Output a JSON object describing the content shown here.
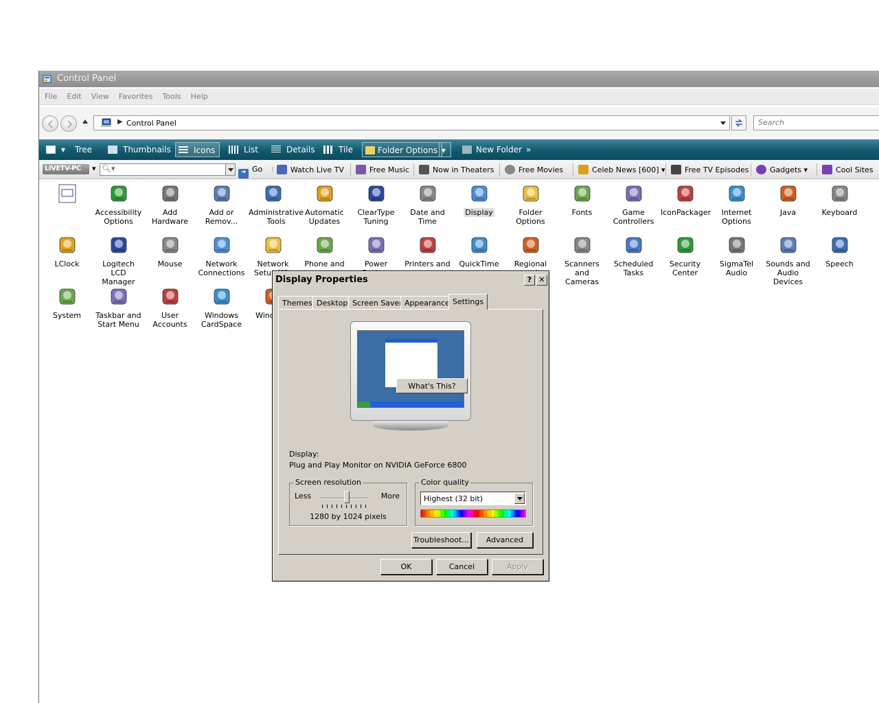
{
  "window": {
    "title": "Control Panel"
  },
  "menubar": [
    "File",
    "Edit",
    "View",
    "Favorites",
    "Tools",
    "Help"
  ],
  "address": {
    "path": "Control Panel",
    "search_placeholder": "Search"
  },
  "commands": {
    "tree": "Tree",
    "thumbnails": "Thumbnails",
    "icons": "Icons",
    "list": "List",
    "details": "Details",
    "tile": "Tile",
    "folder_options": "Folder Options",
    "new_folder": "New Folder",
    "more": "»"
  },
  "links": {
    "logo": "LIVETV-PC",
    "go": "Go",
    "items": [
      "Watch Live TV",
      "Free Music",
      "Now in Theaters",
      "Free Movies",
      "Celeb News [600]",
      "Free TV Episodes",
      "Gadgets",
      "Cool Sites"
    ]
  },
  "items": {
    "r0": [
      "",
      "Accessibility Options",
      "Add Hardware",
      "Add or Remov...",
      "Administrative Tools",
      "Automatic Updates",
      "ClearType Tuning",
      "Date and Time",
      "Display",
      "Folder Options",
      "Fonts",
      "Game Controllers",
      "IconPackager",
      "Internet Options",
      "Java",
      "Keyboard"
    ],
    "r1": [
      "LClock",
      "Logitech LCD Manager",
      "Mouse",
      "Network Connections",
      "Network Setup Wiz",
      "Phone and",
      "Power Options",
      "Printers and",
      "QuickTime",
      "Regional and",
      "Scanners and Cameras",
      "Scheduled Tasks",
      "Security Center",
      "SigmaTel Audio",
      "Sounds and Audio Devices",
      "Speech"
    ],
    "r2": [
      "System",
      "Taskbar and Start Menu",
      "User Accounts",
      "Windows CardSpace",
      "Wind Fire"
    ]
  },
  "dialog": {
    "title": "Display Properties",
    "help": "?",
    "close": "✕",
    "tabs": [
      "Themes",
      "Desktop",
      "Screen Saver",
      "Appearance",
      "Settings"
    ],
    "whats_this": "What's This?",
    "display_label": "Display:",
    "display_value": "Plug and Play Monitor on NVIDIA GeForce 6800",
    "resolution": {
      "label": "Screen resolution",
      "less": "Less",
      "more": "More",
      "value": "1280 by 1024 pixels",
      "position": 0.55
    },
    "color": {
      "label": "Color quality",
      "value": "Highest (32 bit)"
    },
    "buttons": {
      "troubleshoot": "Troubleshoot...",
      "advanced": "Advanced",
      "ok": "OK",
      "cancel": "Cancel",
      "apply": "Apply"
    }
  }
}
